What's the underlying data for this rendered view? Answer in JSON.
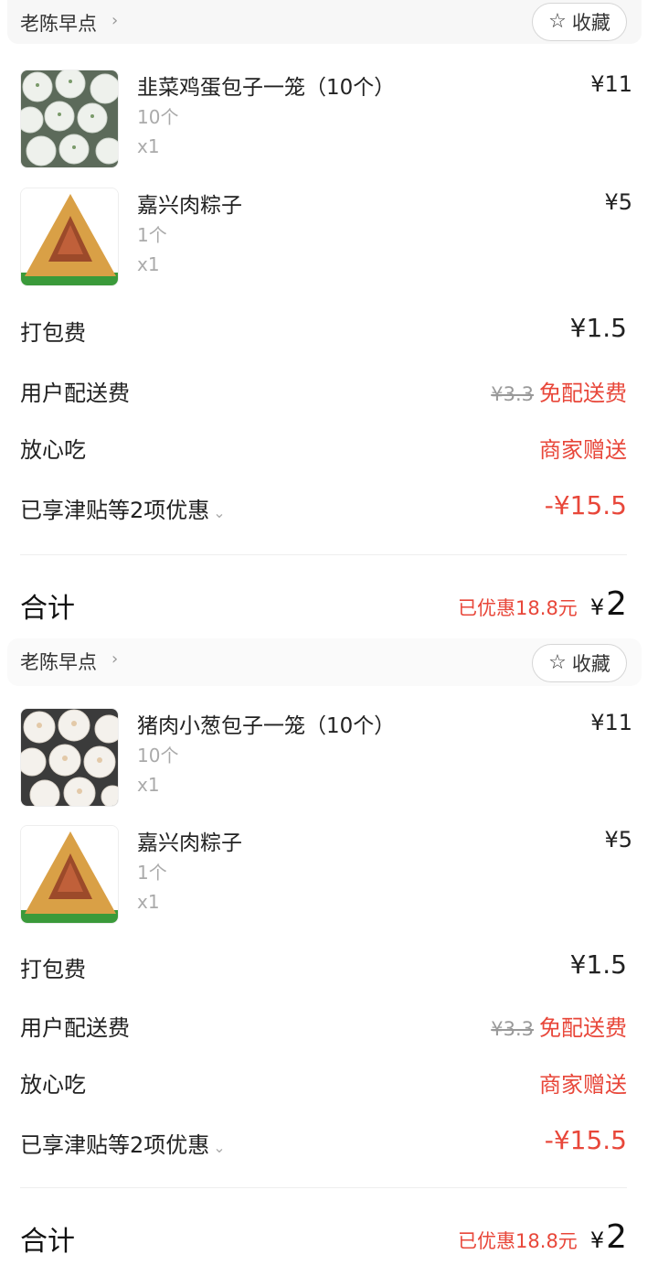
{
  "orders": [
    {
      "shop_name": "老陈早点",
      "shop_chevron": "›",
      "fav_label": "收藏",
      "items": [
        {
          "name": "韭菜鸡蛋包子一笼（10个）",
          "spec": "10个",
          "qty": "x1",
          "price": "¥11",
          "image": "steamed-buns-thumbnail"
        },
        {
          "name": "嘉兴肉粽子",
          "spec": "1个",
          "qty": "x1",
          "price": "¥5",
          "image": "zongzi-thumbnail"
        }
      ],
      "packing_fee": {
        "label": "打包费",
        "value": "¥1.5"
      },
      "delivery_fee": {
        "label": "用户配送费",
        "original": "¥3.3",
        "value": "免配送费"
      },
      "assurance": {
        "label": "放心吃",
        "value": "商家赠送"
      },
      "discounts": {
        "label": "已享津贴等2项优惠",
        "value": "-¥15.5"
      },
      "total": {
        "label": "合计",
        "saved": "已优惠18.8元",
        "yen": "¥",
        "amount": "2"
      }
    },
    {
      "shop_name": "老陈早点",
      "shop_chevron": "›",
      "fav_label": "收藏",
      "items": [
        {
          "name": "猪肉小葱包子一笼（10个）",
          "spec": "10个",
          "qty": "x1",
          "price": "¥11",
          "image": "steamed-buns-thumbnail"
        },
        {
          "name": "嘉兴肉粽子",
          "spec": "1个",
          "qty": "x1",
          "price": "¥5",
          "image": "zongzi-thumbnail"
        }
      ],
      "packing_fee": {
        "label": "打包费",
        "value": "¥1.5"
      },
      "delivery_fee": {
        "label": "用户配送费",
        "original": "¥3.3",
        "value": "免配送费"
      },
      "assurance": {
        "label": "放心吃",
        "value": "商家赠送"
      },
      "discounts": {
        "label": "已享津贴等2项优惠",
        "value": "-¥15.5"
      },
      "total": {
        "label": "合计",
        "saved": "已优惠18.8元",
        "yen": "¥",
        "amount": "2"
      }
    }
  ],
  "colors": {
    "accent_red": "#e8473a",
    "muted": "#aaaaaa",
    "text": "#222222"
  },
  "icons": {
    "favorite": "star-outline-icon",
    "chevron": "chevron-right-icon",
    "expand": "chevron-down-icon"
  }
}
